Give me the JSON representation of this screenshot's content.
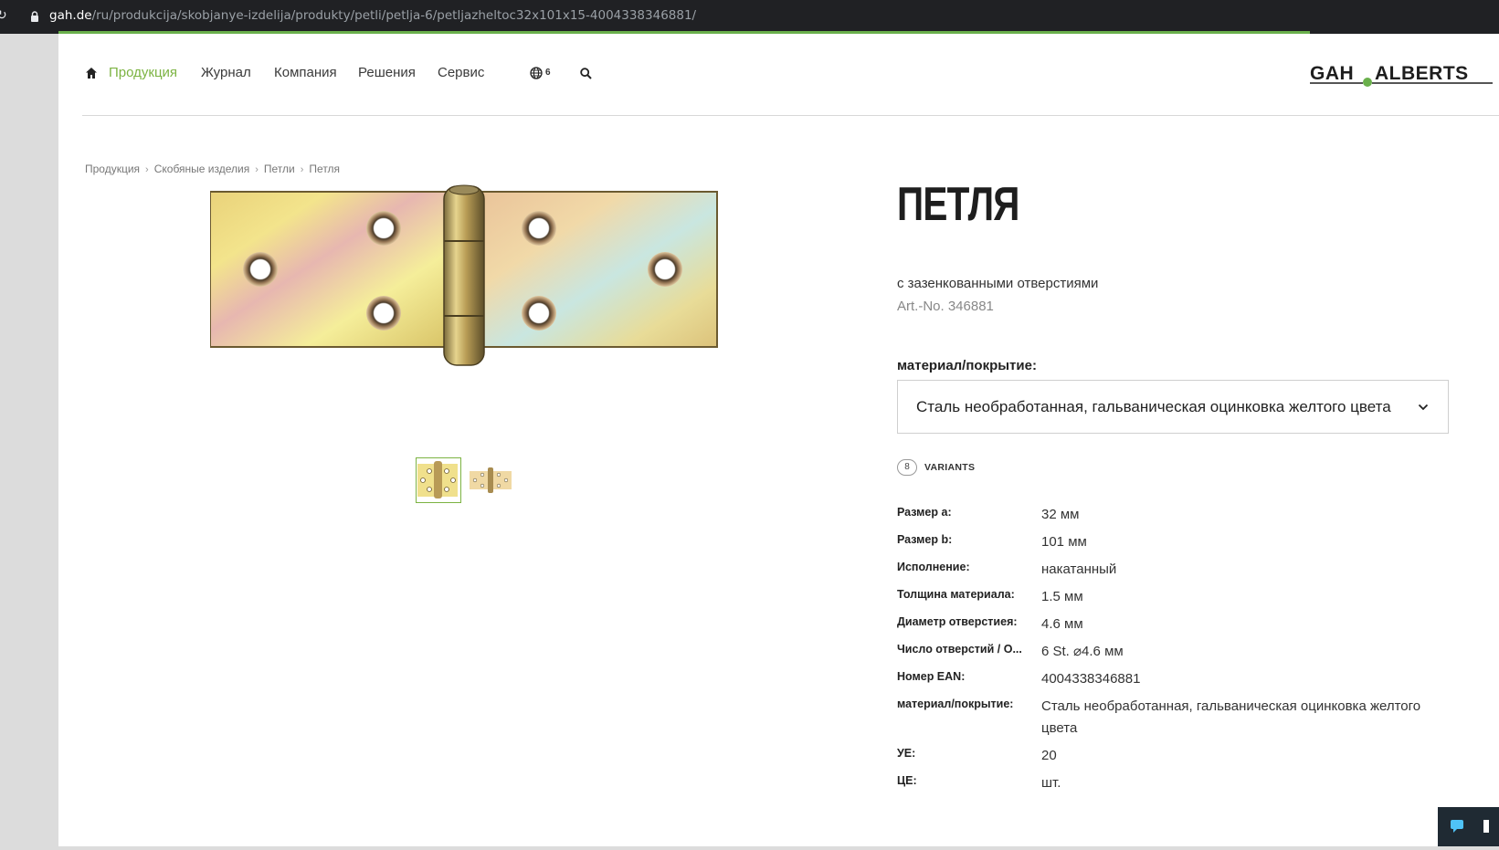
{
  "browser": {
    "url_host": "gah.de",
    "url_path": "/ru/produkcija/skobjanye-izdelija/produkty/petli/petlja-6/petljazheltoc32x101x15-4004338346881/"
  },
  "nav": {
    "items": [
      {
        "label": "Продукция",
        "active": true
      },
      {
        "label": "Журнал"
      },
      {
        "label": "Компания"
      },
      {
        "label": "Решения"
      },
      {
        "label": "Сервис"
      }
    ],
    "lang_count": "6",
    "logo": "GAH ALBERTS"
  },
  "breadcrumb": [
    "Продукция",
    "Скобяные изделия",
    "Петли",
    "Петля"
  ],
  "product": {
    "title": "ПЕТЛЯ",
    "subtitle": "с зазенкованными отверстиями",
    "art_no": "Art.-No. 346881",
    "material_label": "материал/покрытие:",
    "material_selected": "Сталь необработанная, гальваническая оцинковка желтого цвета",
    "variants_count": "8",
    "variants_label": "VARIANTS"
  },
  "specs": [
    {
      "key": "Размер a:",
      "value": "32 мм"
    },
    {
      "key": "Размер b:",
      "value": "101 мм"
    },
    {
      "key": "Исполнение:",
      "value": "накатанный"
    },
    {
      "key": "Толщина материала:",
      "value": "1.5 мм"
    },
    {
      "key": "Диаметр отверстиея:",
      "value": "4.6 мм"
    },
    {
      "key": "Число отверстий / О...",
      "value": "6 St. ⌀4.6 мм"
    },
    {
      "key": "Номер EAN:",
      "value": "4004338346881"
    },
    {
      "key": "материал/покрытие:",
      "value": "Сталь необработанная, гальваническая оцинковка желтого цвета"
    },
    {
      "key": "УЕ:",
      "value": "20"
    },
    {
      "key": "ЦЕ:",
      "value": "шт."
    }
  ],
  "colors": {
    "accent": "#7cb342",
    "text": "#222222"
  }
}
